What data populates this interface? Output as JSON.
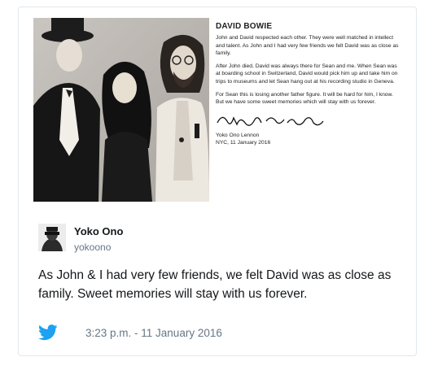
{
  "letter": {
    "title": "DAVID BOWIE",
    "paragraphs": [
      "John and David respected each other. They were well matched in intellect and talent. As John and I had very few friends we felt David was as close as family.",
      "After John died, David was always there for Sean and me. When Sean was at boarding school in Switzerland, David would pick him up and take him on trips to museums and let Sean hang out at his recording studio in Geneva.",
      "For Sean this is losing another father figure. It will be hard for him, I know. But we have some sweet memories which will stay with us forever."
    ],
    "signature_name": "Yoko Ono Lennon",
    "signature_date": "NYC, 11 January 2016"
  },
  "author": {
    "name": "Yoko Ono",
    "handle": "yokoono"
  },
  "tweet": {
    "text": "As John & I had very few friends, we felt David was as close as family. Sweet memories will stay with us forever.",
    "timestamp": "3:23 p.m. - 11 January 2016"
  },
  "colors": {
    "twitter_blue": "#1da1f2",
    "muted_text": "#657786",
    "border": "#e1e8ed"
  },
  "icons": {
    "bird": "twitter-bird-icon"
  }
}
